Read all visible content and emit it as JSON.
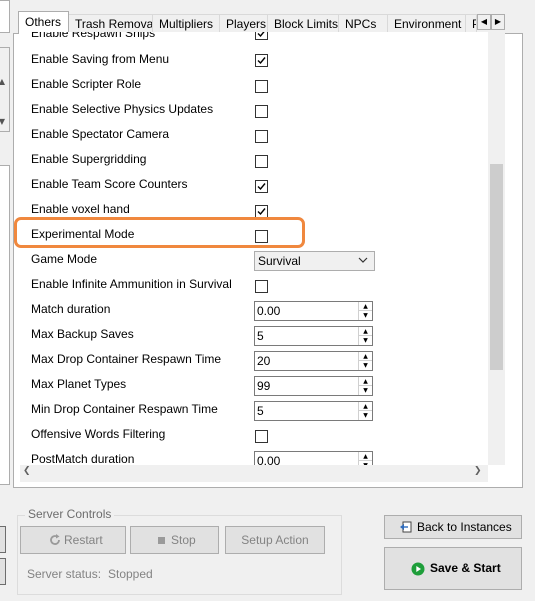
{
  "tabs": [
    {
      "label": "Others",
      "active": true
    },
    {
      "label": "Trash Removal",
      "active": false
    },
    {
      "label": "Multipliers",
      "active": false
    },
    {
      "label": "Players",
      "active": false
    },
    {
      "label": "Block Limits",
      "active": false
    },
    {
      "label": "NPCs",
      "active": false
    },
    {
      "label": "Environment",
      "active": false
    },
    {
      "label": "P",
      "active": false
    }
  ],
  "tab_scroll": {
    "left_icon": "arrow-left-icon",
    "right_icon": "arrow-right-icon"
  },
  "settings": [
    {
      "label": "Enable Respawn Ships",
      "type": "checkbox",
      "checked": true
    },
    {
      "label": "Enable Saving from Menu",
      "type": "checkbox",
      "checked": true
    },
    {
      "label": "Enable Scripter Role",
      "type": "checkbox",
      "checked": false
    },
    {
      "label": "Enable Selective Physics Updates",
      "type": "checkbox",
      "checked": false
    },
    {
      "label": "Enable Spectator Camera",
      "type": "checkbox",
      "checked": false
    },
    {
      "label": "Enable Supergridding",
      "type": "checkbox",
      "checked": false
    },
    {
      "label": "Enable Team Score Counters",
      "type": "checkbox",
      "checked": true
    },
    {
      "label": "Enable voxel hand",
      "type": "checkbox",
      "checked": true
    },
    {
      "label": "Experimental Mode",
      "type": "checkbox",
      "checked": false,
      "highlighted": true
    },
    {
      "label": "Game Mode",
      "type": "select",
      "value": "Survival"
    },
    {
      "label": "Enable Infinite Ammunition in Survival",
      "type": "checkbox",
      "checked": false
    },
    {
      "label": "Match duration",
      "type": "spinner",
      "value": "0.00"
    },
    {
      "label": "Max Backup Saves",
      "type": "spinner",
      "value": "5"
    },
    {
      "label": "Max Drop Container Respawn Time",
      "type": "spinner",
      "value": "20"
    },
    {
      "label": "Max Planet Types",
      "type": "spinner",
      "value": "99"
    },
    {
      "label": "Min Drop Container Respawn Time",
      "type": "spinner",
      "value": "5"
    },
    {
      "label": "Offensive Words Filtering",
      "type": "checkbox",
      "checked": false
    },
    {
      "label": "PostMatch duration",
      "type": "spinner",
      "value": "0.00"
    }
  ],
  "server_controls": {
    "title": "Server Controls",
    "restart_label": "Restart",
    "stop_label": "Stop",
    "setup_action_label": "Setup Action",
    "status_label": "Server status:",
    "status_value": "Stopped"
  },
  "actions": {
    "back_label": "Back to Instances",
    "save_start_label": "Save & Start"
  },
  "colors": {
    "highlight": "#f0883e",
    "save_start_icon": "#1e9e3a"
  }
}
